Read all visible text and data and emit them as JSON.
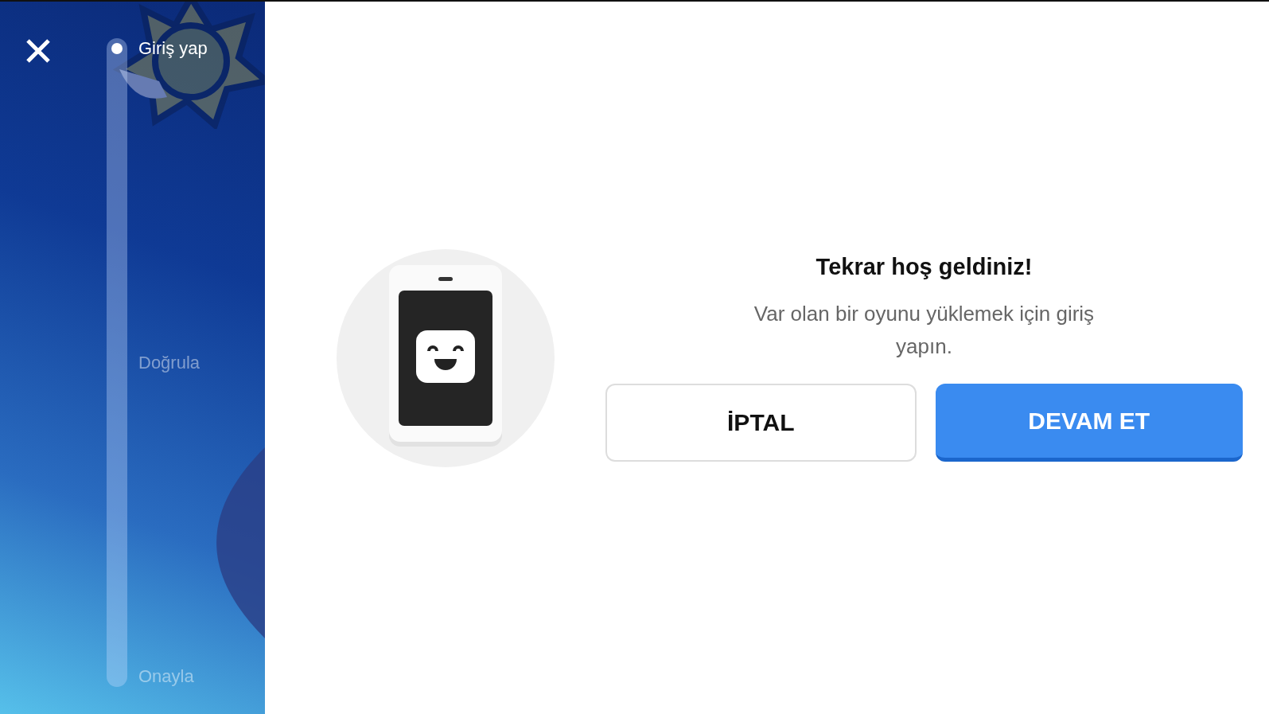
{
  "steps": [
    {
      "label": "Giriş yap",
      "selected": true
    },
    {
      "label": "Doğrula",
      "selected": false
    },
    {
      "label": "Onayla",
      "selected": false
    }
  ],
  "dialog": {
    "title": "Tekrar hoş geldiniz!",
    "message": "Var olan bir oyunu yüklemek için giriş yapın.",
    "buttons": [
      {
        "label": "İPTAL",
        "kind": "secondary"
      },
      {
        "label": "DEVAM ET",
        "kind": "primary"
      }
    ]
  }
}
